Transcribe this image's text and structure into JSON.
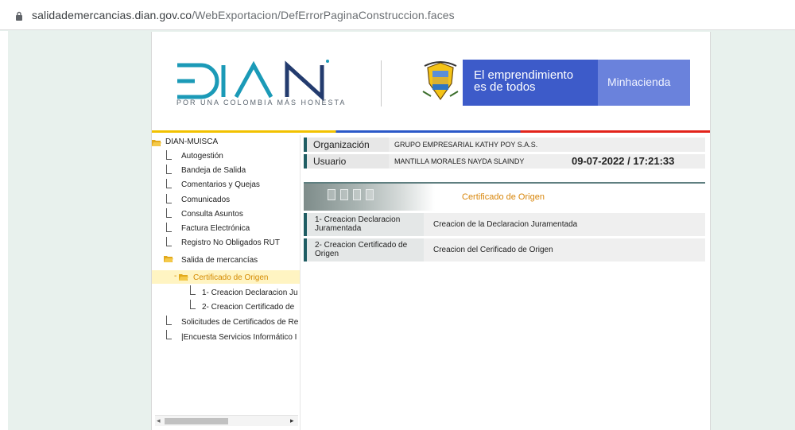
{
  "browser": {
    "url_host": "salidademercancias.dian.gov.co",
    "url_path": "/WebExportacion/DefErrorPaginaConstruccion.faces"
  },
  "header": {
    "logo_text": "DIAN",
    "tagline": "POR UNA COLOMBIA MÁS HONESTA",
    "banner_line1": "El emprendimiento",
    "banner_line2": "es de todos",
    "banner_ministry": "Minhacienda"
  },
  "tree": {
    "root": "DIAN-MUISCA",
    "items": [
      "Autogestión",
      "Bandeja de Salida",
      "Comentarios y Quejas",
      "Comunicados",
      "Consulta Asuntos",
      "Factura Electrónica",
      "Registro No Obligados RUT"
    ],
    "folder": "Salida de mercancías",
    "selected": "Certificado de Origen",
    "sub_items": [
      "1- Creacion Declaracion Ju",
      "2- Creacion Certificado de"
    ],
    "after_items": [
      "Solicitudes de Certificados de Re",
      "|Encuesta Servicios Informático I"
    ],
    "scroll_left": "◂",
    "scroll_right": "▸"
  },
  "info": {
    "org_label": "Organización",
    "org_value": "GRUPO EMPRESARIAL KATHY POY S.A.S.",
    "user_label": "Usuario",
    "user_value": "MANTILLA MORALES NAYDA SLAINDY",
    "datetime": "09-07-2022 / 17:21:33"
  },
  "section": {
    "title": "Certificado de Origen"
  },
  "menu": [
    {
      "key": "1- Creacion Declaracion Juramentada",
      "desc": "Creacion de la Declaracion Juramentada"
    },
    {
      "key": "2- Creacion Certificado de Origen",
      "desc": "Creacion del Cerificado de Origen"
    }
  ],
  "colors": {
    "accent_orange": "#d8860b",
    "banner_blue": "#3d5bc9",
    "label_bar": "#1f5d63"
  }
}
